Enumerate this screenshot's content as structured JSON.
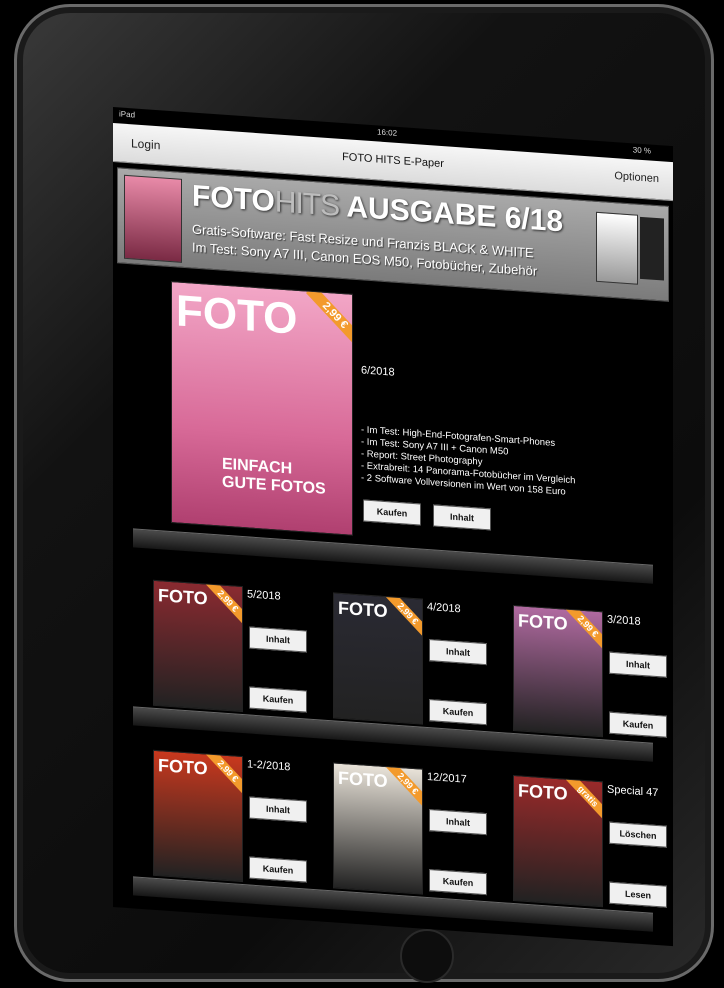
{
  "device": {
    "status": {
      "carrier": "iPad",
      "time": "16:02",
      "battery": "30 %"
    }
  },
  "navbar": {
    "login": "Login",
    "title": "FOTO HITS E-Paper",
    "options": "Optionen"
  },
  "banner": {
    "brand_foto": "FOTO",
    "brand_hits": "HITS",
    "issue_label": "AUSGABE 6/18",
    "line1": "Gratis-Software: Fast Resize und Franzis BLACK & WHITE",
    "line2": "Im Test: Sony A7 III, Canon EOS M50, Fotobücher, Zubehör"
  },
  "featured": {
    "issue": "6/2018",
    "masthead": "FOTO",
    "price": "2,99 €",
    "headline1": "EINFACH",
    "headline2": "GUTE FOTOS",
    "bullets": [
      "- Im Test: High-End-Fotografen-Smart-Phones",
      "- Im Test: Sony A7 III + Canon M50",
      "- Report: Street Photography",
      "- Extrabreit: 14 Panorama-Fotobücher im Vergleich",
      "- 2 Software Vollversionen im Wert von 158 Euro"
    ],
    "buy": "Kaufen",
    "contents": "Inhalt"
  },
  "issues": [
    {
      "issue": "5/2018",
      "masthead": "FOTO",
      "price": "2,99 €",
      "btn1": "Inhalt",
      "btn2": "Kaufen",
      "color": "#8a2a30"
    },
    {
      "issue": "4/2018",
      "masthead": "FOTO",
      "price": "2,99 €",
      "btn1": "Inhalt",
      "btn2": "Kaufen",
      "color": "#2a2a33"
    },
    {
      "issue": "3/2018",
      "masthead": "FOTO",
      "price": "2,99 €",
      "btn1": "Inhalt",
      "btn2": "Kaufen",
      "color": "#b06aa0"
    },
    {
      "issue": "1-2/2018",
      "masthead": "FOTO",
      "price": "2,99 €",
      "btn1": "Inhalt",
      "btn2": "Kaufen",
      "color": "#c8381e"
    },
    {
      "issue": "12/2017",
      "masthead": "FOTO",
      "price": "2,99 €",
      "btn1": "Inhalt",
      "btn2": "Kaufen",
      "color": "#e8e2d8"
    },
    {
      "issue": "Special 47",
      "masthead": "FOTO",
      "price": "gratis",
      "btn1": "Löschen",
      "btn2": "Lesen",
      "color": "#9a2a2a"
    }
  ]
}
